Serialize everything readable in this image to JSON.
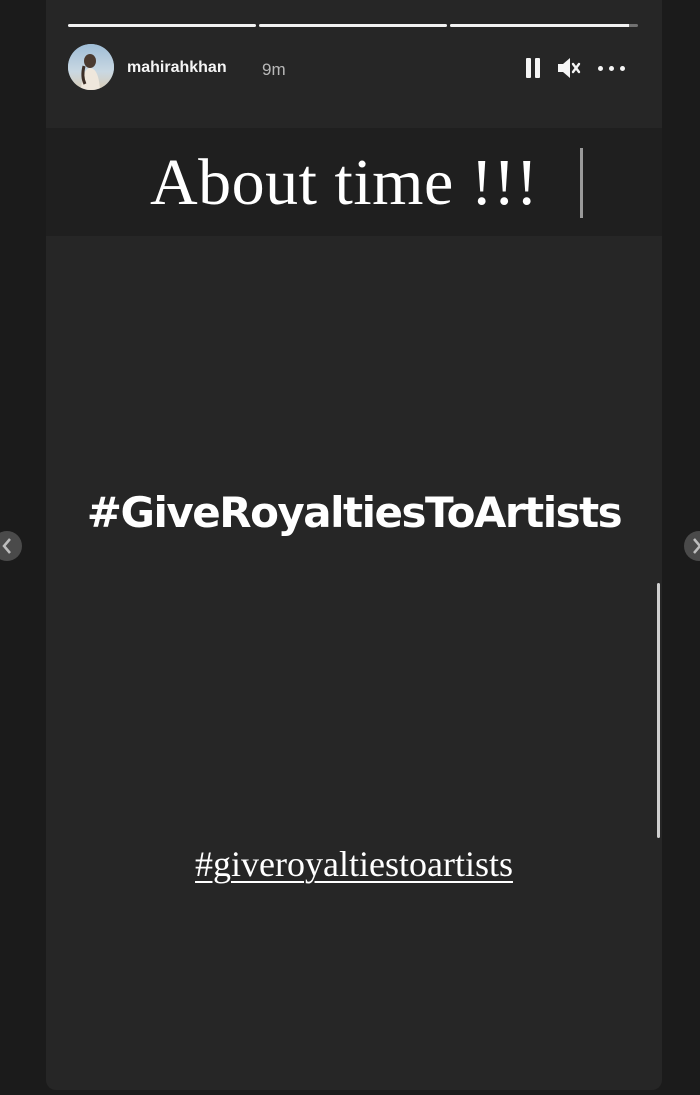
{
  "header": {
    "username": "mahirahkhan",
    "time_ago": "9m",
    "avatar_icon": "profile-photo",
    "pause_icon": "pause-icon",
    "mute_icon": "muted-speaker-icon",
    "more_icon": "more-options-icon"
  },
  "progress": {
    "segments": 3,
    "current_segment_progress": 0.95
  },
  "story": {
    "title": "About time !!!",
    "hashtag_main": "#GiveRoyaltiesToArtists",
    "hashtag_link": "#giveroyaltiestoartists"
  },
  "colors": {
    "story_background": "#262626",
    "page_background": "#1b1b1b",
    "text": "#ffffff"
  }
}
